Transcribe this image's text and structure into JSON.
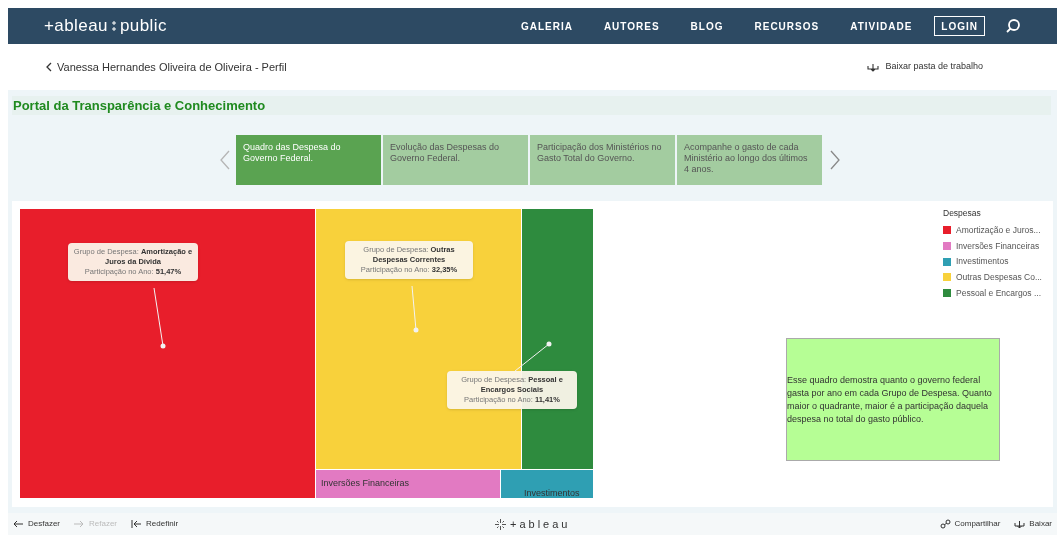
{
  "header": {
    "logo": [
      "+ableau",
      "public"
    ],
    "nav": [
      "GALERIA",
      "AUTORES",
      "BLOG",
      "RECURSOS",
      "ATIVIDADE"
    ],
    "login": "LOGIN"
  },
  "breadcrumb": "Vanessa Hernandes Oliveira de Oliveira - Perfil",
  "download": "Baixar pasta de trabalho",
  "dashboard": {
    "title": "Portal da Transparência e Conhecimento",
    "story_points": [
      {
        "label": "Quadro das Despesa do Governo Federal.",
        "selected": true
      },
      {
        "label": "Evolução das Despesas do Governo Federal.",
        "selected": false
      },
      {
        "label": "Participação dos Ministérios no Gasto Total do Governo.",
        "selected": false
      },
      {
        "label": "Acompanhe o gasto de cada Ministério ao longo dos últimos 4 anos.",
        "selected": false
      }
    ],
    "treemap": {
      "tiles": [
        {
          "color": "#e81e2b"
        },
        {
          "color": "#f8d13b"
        },
        {
          "color": "#2e8b3e"
        },
        {
          "color": "#e27ac2",
          "label": "Inversões Financeiras"
        },
        {
          "color": "#2f9fb3",
          "label": "Investimentos"
        }
      ],
      "tooltips": [
        {
          "group": "Grupo de Despesa: **Amortização e Juros da Dívida**",
          "share": "Participação no Ano: **51,47%**"
        },
        {
          "group": "Grupo de Despesa: **Outras Despesas Correntes**",
          "share": "Participação no Ano: **32,35%**"
        },
        {
          "group": "Grupo de Despesa: **Pessoal e Encargos Sociais**",
          "share": "Participação no Ano: **11,41%**"
        }
      ]
    },
    "legend": {
      "title": "Despesas",
      "items": [
        {
          "label": "Amortização e Juros...",
          "color": "#e81e2b"
        },
        {
          "label": "Inversões Financeiras",
          "color": "#e27ac2"
        },
        {
          "label": "Investimentos",
          "color": "#2f9fb3"
        },
        {
          "label": "Outras Despesas Co...",
          "color": "#f8d13b"
        },
        {
          "label": "Pessoal e Encargos ...",
          "color": "#2e8b3e"
        }
      ]
    },
    "note": "Esse quadro demostra quanto o governo federal gasta por ano em cada Grupo de Despesa. Quanto maior o quadrante, maior é a participação daquela despesa no total do gasto público."
  },
  "toolbar": {
    "left": [
      {
        "label": "Desfazer",
        "kind": "undo",
        "disabled": false
      },
      {
        "label": "Refazer",
        "kind": "redo",
        "disabled": true
      },
      {
        "label": "Redefinir",
        "kind": "reset",
        "disabled": false
      }
    ],
    "center": "+ableau",
    "right": [
      {
        "label": "Compartilhar",
        "kind": "share"
      },
      {
        "label": "Baixar",
        "kind": "download"
      }
    ]
  }
}
